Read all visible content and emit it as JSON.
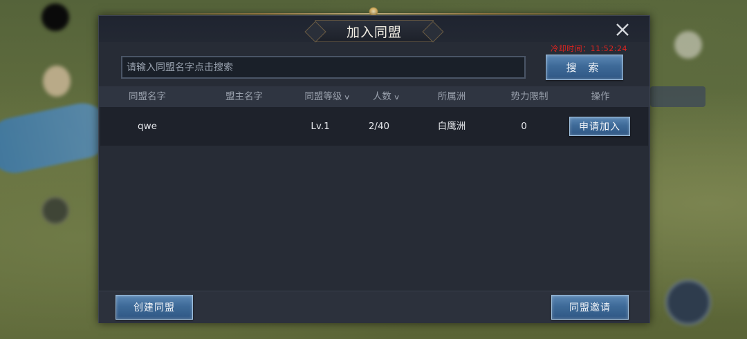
{
  "dialog": {
    "title": "加入同盟",
    "cooldown": "冷却时间：11:52:24"
  },
  "search": {
    "placeholder": "请输入同盟名字点击搜索",
    "button_label": "搜 索"
  },
  "table": {
    "headers": [
      "同盟名字",
      "盟主名字",
      "同盟等级",
      "人数",
      "所属洲",
      "势力限制",
      "操作"
    ],
    "rows": [
      {
        "name": "qwe",
        "leader": "",
        "level": "Lv.1",
        "members": "2/40",
        "continent": "白鹰洲",
        "power_limit": "0",
        "action": "申请加入"
      }
    ]
  },
  "footer": {
    "create_label": "创建同盟",
    "invite_label": "同盟邀请"
  },
  "icons": {
    "close": "close-icon",
    "sort": "chevron-down-icon"
  },
  "colors": {
    "panel": "#272c36",
    "header_row": "#2f3541",
    "accent_blue": "#3e6a98",
    "cooldown_red": "#e3241f",
    "gold": "#b89254"
  }
}
